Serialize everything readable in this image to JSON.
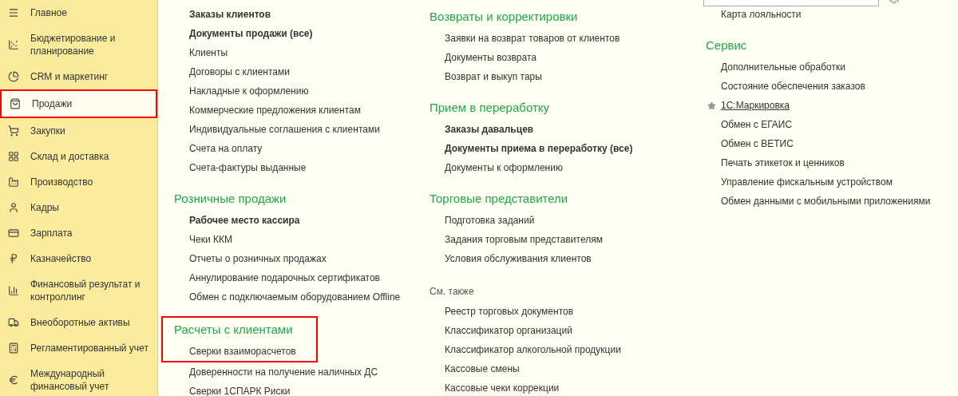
{
  "sidebar": {
    "items": [
      {
        "label": "Главное",
        "selected": false
      },
      {
        "label": "Бюджетирование и планирование",
        "selected": false
      },
      {
        "label": "CRM и маркетинг",
        "selected": false
      },
      {
        "label": "Продажи",
        "selected": true
      },
      {
        "label": "Закупки",
        "selected": false
      },
      {
        "label": "Склад и доставка",
        "selected": false
      },
      {
        "label": "Производство",
        "selected": false
      },
      {
        "label": "Кадры",
        "selected": false
      },
      {
        "label": "Зарплата",
        "selected": false
      },
      {
        "label": "Казначейство",
        "selected": false
      },
      {
        "label": "Финансовый результат и контроллинг",
        "selected": false
      },
      {
        "label": "Внеоборотные активы",
        "selected": false
      },
      {
        "label": "Регламентированный учет",
        "selected": false
      },
      {
        "label": "Международный финансовый учет",
        "selected": false
      }
    ]
  },
  "columns": [
    [
      {
        "highlighted": false,
        "items": [
          {
            "label": "Заказы клиентов",
            "bold": true,
            "starred": false
          },
          {
            "label": "Документы продажи (все)",
            "bold": true,
            "starred": false
          },
          {
            "label": "Клиенты",
            "bold": false,
            "starred": false
          },
          {
            "label": "Договоры с клиентами",
            "bold": false,
            "starred": false
          },
          {
            "label": "Накладные к оформлению",
            "bold": false,
            "starred": false
          },
          {
            "label": "Коммерческие предложения клиентам",
            "bold": false,
            "starred": false
          },
          {
            "label": "Индивидуальные соглашения с клиентами",
            "bold": false,
            "starred": false
          },
          {
            "label": "Счета на оплату",
            "bold": false,
            "starred": false
          },
          {
            "label": "Счета-фактуры выданные",
            "bold": false,
            "starred": false
          }
        ]
      },
      {
        "kind": "group",
        "title": "Розничные продажи",
        "highlighted": false,
        "items": [
          {
            "label": "Рабочее место кассира",
            "bold": true,
            "starred": false
          },
          {
            "label": "Чеки ККМ",
            "bold": false,
            "starred": false
          },
          {
            "label": "Отчеты о розничных продажах",
            "bold": false,
            "starred": false
          },
          {
            "label": "Аннулирование подарочных сертификатов",
            "bold": false,
            "starred": false
          },
          {
            "label": "Обмен с подключаемым оборудованием Offline",
            "bold": false,
            "starred": false
          }
        ]
      },
      {
        "kind": "group",
        "title": "Расчеты с клиентами",
        "highlighted": true,
        "items": [
          {
            "label": "Сверки взаиморасчетов",
            "bold": false,
            "starred": false
          },
          {
            "label": "Доверенности на получение наличных ДС",
            "bold": false,
            "starred": false
          },
          {
            "label": "Сверки 1СПАРК Риски",
            "bold": false,
            "starred": false
          }
        ]
      }
    ],
    [
      {
        "kind": "group",
        "title": "Возвраты и корректировки",
        "highlighted": false,
        "items": [
          {
            "label": "Заявки на возврат товаров от клиентов",
            "bold": false,
            "starred": false
          },
          {
            "label": "Документы возврата",
            "bold": false,
            "starred": false
          },
          {
            "label": "Возврат и выкуп тары",
            "bold": false,
            "starred": false
          }
        ]
      },
      {
        "kind": "group",
        "title": "Прием в переработку",
        "highlighted": false,
        "items": [
          {
            "label": "Заказы давальцев",
            "bold": true,
            "starred": false
          },
          {
            "label": "Документы приема в переработку (все)",
            "bold": true,
            "starred": false
          },
          {
            "label": "Документы к оформлению",
            "bold": false,
            "starred": false
          }
        ]
      },
      {
        "kind": "group",
        "title": "Торговые представители",
        "highlighted": false,
        "items": [
          {
            "label": "Подготовка заданий",
            "bold": false,
            "starred": false
          },
          {
            "label": "Задания торговым представителям",
            "bold": false,
            "starred": false
          },
          {
            "label": "Условия обслуживания клиентов",
            "bold": false,
            "starred": false
          }
        ]
      },
      {
        "kind": "see_also",
        "title": "См. также",
        "highlighted": false,
        "items": [
          {
            "label": "Реестр торговых документов",
            "bold": false,
            "starred": false
          },
          {
            "label": "Классификатор организаций",
            "bold": false,
            "starred": false
          },
          {
            "label": "Классификатор алкогольной продукции",
            "bold": false,
            "starred": false
          },
          {
            "label": "Кассовые смены",
            "bold": false,
            "starred": false
          },
          {
            "label": "Кассовые чеки коррекции",
            "bold": false,
            "starred": false
          }
        ]
      }
    ],
    [
      {
        "highlighted": false,
        "items": [
          {
            "label": "Карта лояльности",
            "bold": false,
            "starred": false
          }
        ]
      },
      {
        "kind": "group",
        "title": "Сервис",
        "highlighted": false,
        "items": [
          {
            "label": "Дополнительные обработки",
            "bold": false,
            "starred": false
          },
          {
            "label": "Состояние обеспечения заказов",
            "bold": false,
            "starred": false
          },
          {
            "label": "1С:Маркировка",
            "bold": false,
            "starred": true
          },
          {
            "label": "Обмен с ЕГАИС",
            "bold": false,
            "starred": false
          },
          {
            "label": "Обмен с ВЕТИС",
            "bold": false,
            "starred": false
          },
          {
            "label": "Печать этикеток и ценников",
            "bold": false,
            "starred": false
          },
          {
            "label": "Управление фискальным устройством",
            "bold": false,
            "starred": false
          },
          {
            "label": "Обмен данными с мобильными приложениями",
            "bold": false,
            "starred": false
          }
        ]
      }
    ]
  ]
}
